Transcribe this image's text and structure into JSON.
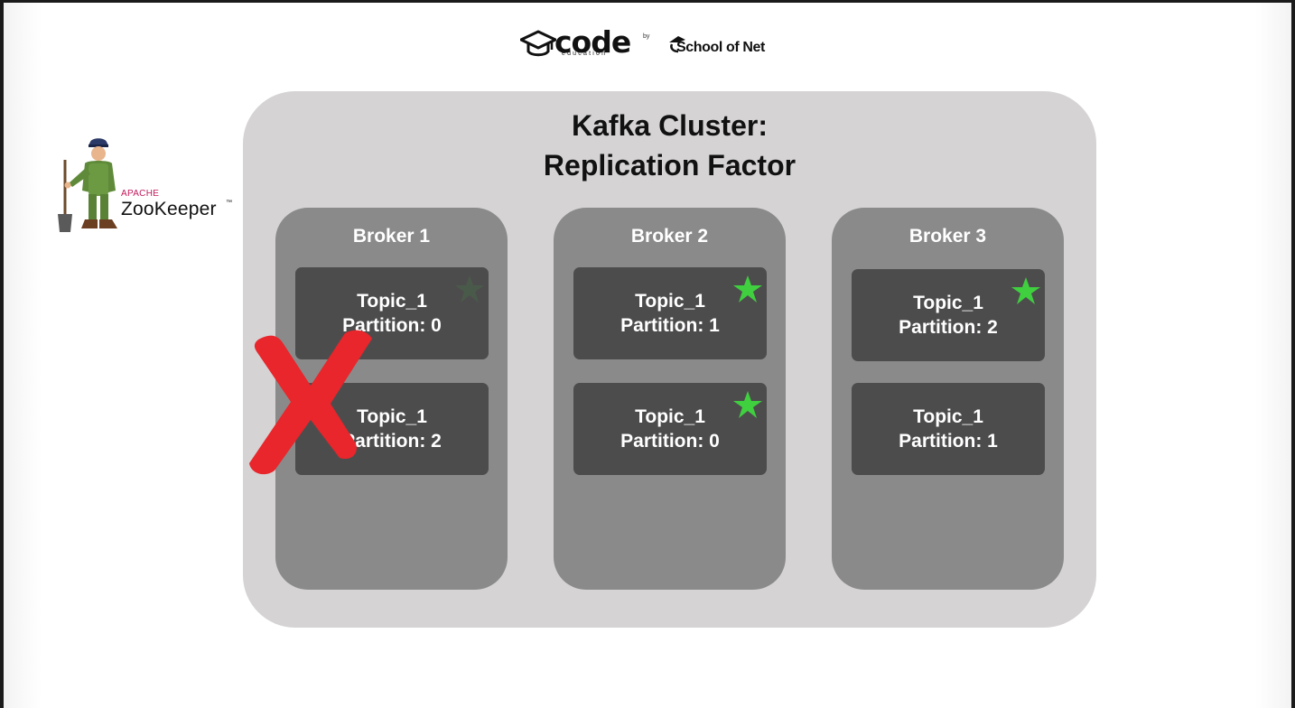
{
  "header": {
    "code_logo_word": "code",
    "code_logo_sub": "education",
    "by": "by",
    "school_logo_word": "School of Net"
  },
  "zookeeper": {
    "apache": "APACHE",
    "name": "ZooKeeper",
    "tm": "™"
  },
  "cluster": {
    "title_line1": "Kafka Cluster:",
    "title_line2": "Replication Factor",
    "brokers": [
      {
        "name": "Broker 1",
        "partitions": [
          {
            "topic": "Topic_1",
            "partition": "Partition: 0",
            "leader_star": "faded"
          },
          {
            "topic": "Topic_1",
            "partition": "Partition: 2",
            "leader_star": "none"
          }
        ],
        "status": "failed"
      },
      {
        "name": "Broker 2",
        "partitions": [
          {
            "topic": "Topic_1",
            "partition": "Partition: 1",
            "leader_star": "active"
          },
          {
            "topic": "Topic_1",
            "partition": "Partition: 0",
            "leader_star": "active"
          }
        ],
        "status": "ok"
      },
      {
        "name": "Broker 3",
        "partitions": [
          {
            "topic": "Topic_1",
            "partition": "Partition: 2",
            "leader_star": "active"
          },
          {
            "topic": "Topic_1",
            "partition": "Partition: 1",
            "leader_star": "none"
          }
        ],
        "status": "ok"
      }
    ]
  },
  "colors": {
    "cluster_bg": "#d5d3d4",
    "broker_bg": "#8a8a8a",
    "partition_bg": "#4d4c4d",
    "leader_star": "#3fcf3f",
    "leader_star_faded": "#4a5a4a",
    "failure_x": "#e8262b",
    "zookeeper_apache": "#c2185b"
  },
  "icons": {
    "leader": "star-icon",
    "failure": "x-cross-icon",
    "zookeeper": "zookeeper-mascot-icon",
    "code_logo": "graduation-cap-icon",
    "school_logo": "school-of-net-mark-icon"
  }
}
